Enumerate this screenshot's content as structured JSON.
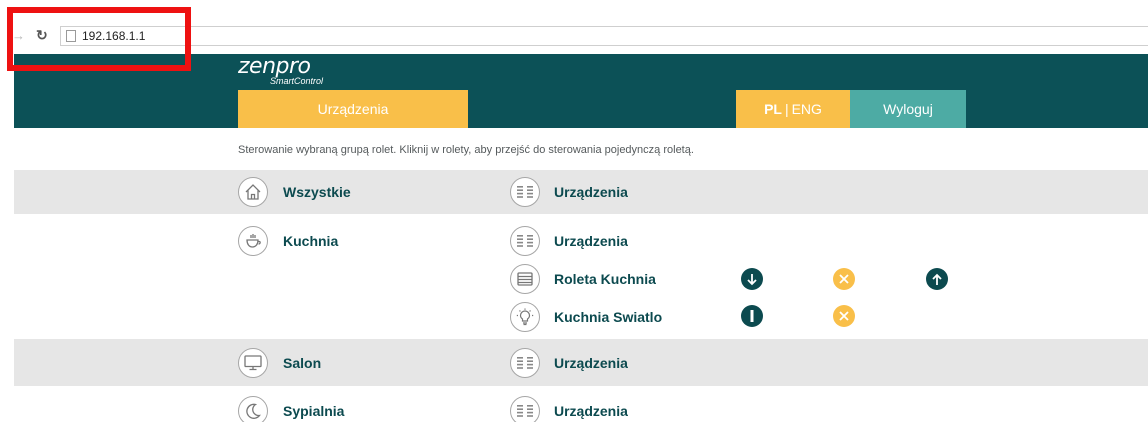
{
  "browser": {
    "url": "192.168.1.1",
    "forward_icon": "arrow-right-icon",
    "reload_icon": "reload-icon",
    "page_icon": "page-icon"
  },
  "header": {
    "logo": "zenpro",
    "logo_subtitle": "SmartControl",
    "devices_button": "Urządzenia",
    "lang_active": "PL",
    "lang_separator": "|",
    "lang_other": "ENG",
    "logout_button": "Wyloguj"
  },
  "instruction": "Sterowanie wybraną grupą rolet. Kliknij w rolety, aby przejść do sterowania pojedynczą roletą.",
  "colors": {
    "header_bg": "#0c5157",
    "accent_yellow": "#f9bf49",
    "logout_teal": "#4daba4",
    "row_band": "#e6e6e6",
    "text_dark": "#0c4a4f",
    "highlight_red": "#ee1111"
  },
  "rooms": [
    {
      "label": "Wszystkie",
      "icon": "home-icon",
      "device_label": "Urządzenia",
      "device_icon": "devices-icon"
    },
    {
      "label": "Kuchnia",
      "icon": "cup-icon",
      "device_label": "Urządzenia",
      "device_icon": "devices-icon",
      "devices": [
        {
          "label": "Roleta Kuchnia",
          "icon": "blinds-icon",
          "actions": [
            "arrow-down-icon",
            "stop-x-icon",
            "arrow-up-icon"
          ]
        },
        {
          "label": "Kuchnia Swiatlo",
          "icon": "bulb-icon",
          "actions": [
            "power-on-icon",
            "off-x-icon"
          ]
        }
      ]
    },
    {
      "label": "Salon",
      "icon": "tv-icon",
      "device_label": "Urządzenia",
      "device_icon": "devices-icon"
    },
    {
      "label": "Sypialnia",
      "icon": "moon-icon",
      "device_label": "Urządzenia",
      "device_icon": "devices-icon"
    }
  ]
}
